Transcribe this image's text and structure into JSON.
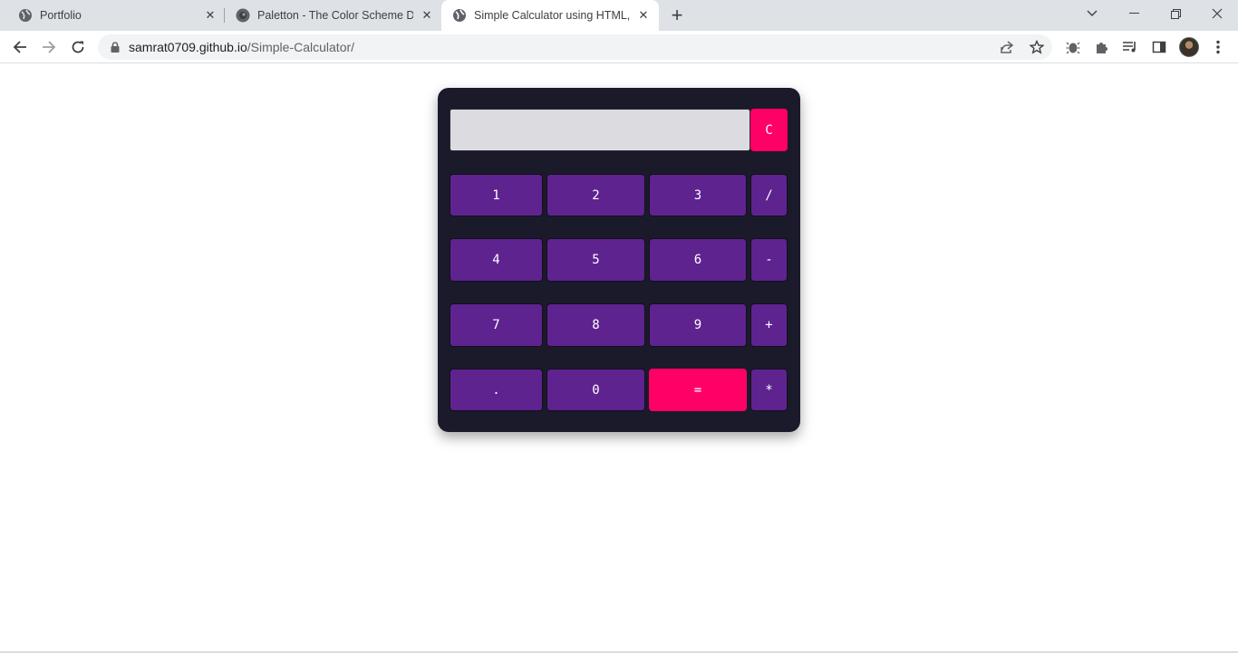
{
  "browser": {
    "tabs": [
      {
        "title": "Portfolio",
        "active": false
      },
      {
        "title": "Paletton - The Color Scheme Designer",
        "active": false
      },
      {
        "title": "Simple Calculator using HTML, CSS & JavaScript",
        "active": true
      }
    ],
    "new_tab_symbol": "+",
    "url_host": "samrat0709.github.io",
    "url_path": "/Simple-Calculator/"
  },
  "calculator": {
    "display_value": "",
    "clear_label": "C",
    "rows": [
      [
        "1",
        "2",
        "3",
        "/"
      ],
      [
        "4",
        "5",
        "6",
        "-"
      ],
      [
        "7",
        "8",
        "9",
        "+"
      ],
      [
        ".",
        "0",
        "=",
        "*"
      ]
    ]
  },
  "colors": {
    "body_bg": "#1b1a2b",
    "key_bg": "#5f2390",
    "accent": "#ff0066",
    "display_bg": "#dcdbe0"
  },
  "icons": [
    "globe-icon",
    "paletton-icon",
    "close-icon",
    "plus-icon",
    "chevron-down-icon",
    "minimize-icon",
    "restore-icon",
    "back-arrow-icon",
    "forward-arrow-icon",
    "reload-icon",
    "lock-icon",
    "share-icon",
    "star-icon",
    "bug-icon",
    "puzzle-icon",
    "media-icon",
    "side-panel-icon",
    "kebab-menu-icon"
  ]
}
